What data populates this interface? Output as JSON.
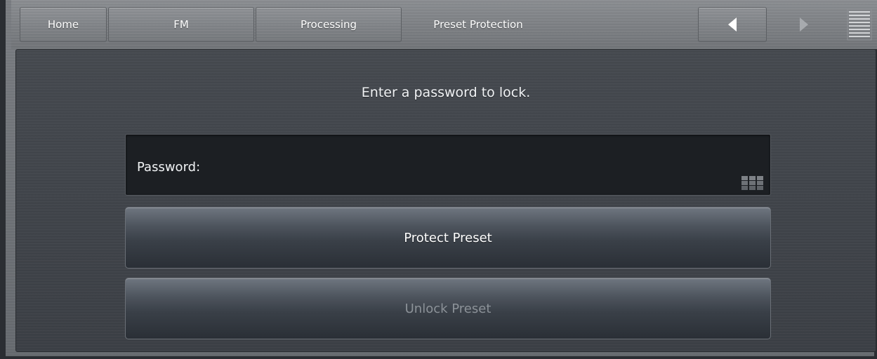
{
  "nav": {
    "home_label": "Home",
    "fm_label": "FM",
    "processing_label": "Processing",
    "title": "Preset Protection",
    "back_icon": "triangle-left-icon",
    "forward_icon": "triangle-right-icon",
    "menu_icon": "menu-lines-icon"
  },
  "main": {
    "instruction": "Enter a password to lock.",
    "password_label": "Password:",
    "password_value": "",
    "keypad_icon": "keypad-grid-icon",
    "protect_button_label": "Protect Preset",
    "unlock_button_label": "Unlock Preset",
    "unlock_button_enabled": false
  },
  "colors": {
    "panel_background": "#42464c",
    "field_background": "#1c1f23",
    "text_primary": "#f1f3f5",
    "text_disabled": "#8c9298"
  }
}
